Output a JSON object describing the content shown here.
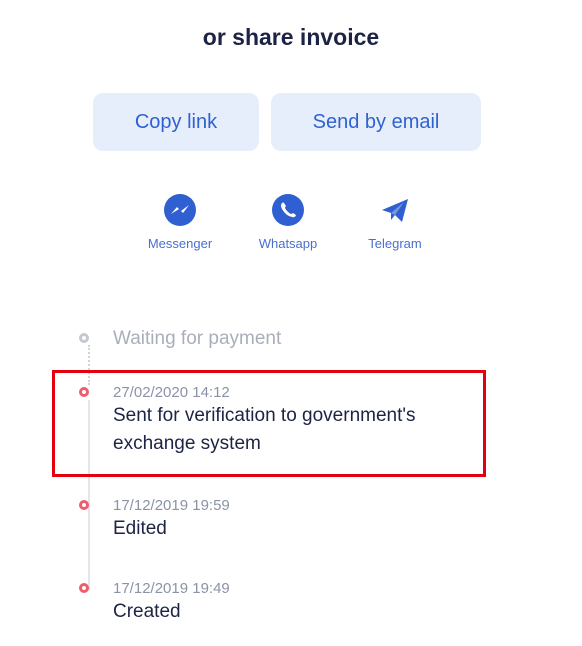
{
  "header": {
    "title": "or share invoice"
  },
  "actions": {
    "copy_link": "Copy link",
    "send_email": "Send by email"
  },
  "share": [
    {
      "label": "Messenger",
      "icon": "messenger-icon"
    },
    {
      "label": "Whatsapp",
      "icon": "whatsapp-icon"
    },
    {
      "label": "Telegram",
      "icon": "telegram-icon"
    }
  ],
  "timeline": [
    {
      "status": "Waiting for payment",
      "time": "",
      "state": "pending"
    },
    {
      "time": "27/02/2020 14:12",
      "status": "Sent for verification to government's",
      "status_line2": "exchange system",
      "state": "done"
    },
    {
      "time": "17/12/2019 19:59",
      "status": "Edited",
      "state": "done"
    },
    {
      "time": "17/12/2019 19:49",
      "status": "Created",
      "state": "done"
    }
  ],
  "colors": {
    "accent": "#2f62d1",
    "button_bg": "#e7eefb",
    "dot_red": "#ef5d6b",
    "highlight": "#e3000f"
  }
}
